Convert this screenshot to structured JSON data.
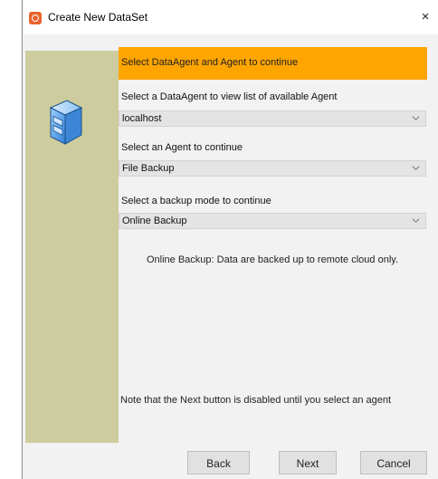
{
  "window": {
    "title": "Create New DataSet",
    "close_glyph": "×"
  },
  "banner": {
    "text": "Select DataAgent and Agent to continue",
    "color": "#ffa500"
  },
  "fields": [
    {
      "label": "Select a DataAgent to view list of available Agent",
      "value": "localhost"
    },
    {
      "label": "Select an Agent to continue",
      "value": "File Backup"
    },
    {
      "label": "Select a backup mode to continue",
      "value": "Online Backup"
    }
  ],
  "info_text": "Online Backup: Data are backed up to remote cloud only.",
  "note_text": "Note that the Next button is disabled until you select an agent",
  "buttons": {
    "back": "Back",
    "next": "Next",
    "cancel": "Cancel"
  },
  "icons": {
    "app": "app-icon",
    "database": "database-icon",
    "dropdown": "chevron-down-icon"
  },
  "colors": {
    "side_panel": "#cdcc9e",
    "banner": "#ffa500"
  }
}
